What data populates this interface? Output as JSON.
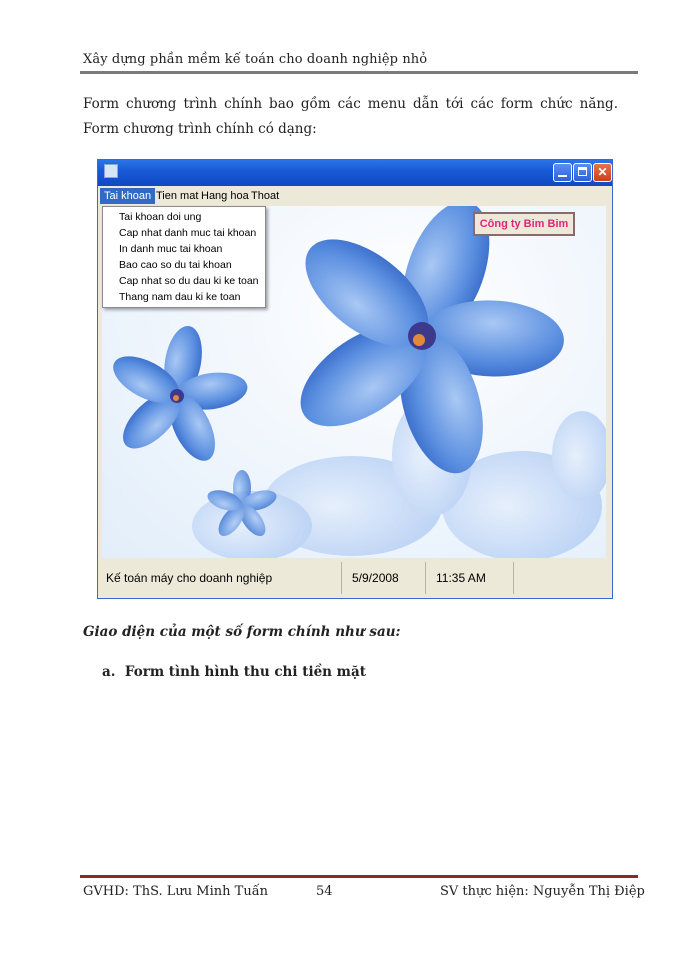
{
  "header": {
    "title": "Xây dựng phần mềm kế toán cho doanh nghiệp  nhỏ"
  },
  "intro": "Form chương trình chính bao gồm các menu dẫn tới các form chức năng. Form chương trình chính có dạng:",
  "app_window": {
    "menu": [
      {
        "label": "Tai khoan",
        "active": true
      },
      {
        "label": "Tien mat",
        "active": false
      },
      {
        "label": "Hang hoa",
        "active": false
      },
      {
        "label": "Thoat",
        "active": false
      }
    ],
    "dropdown_items": [
      "Tai khoan doi ung",
      "Cap nhat danh muc tai khoan",
      "In danh muc tai khoan",
      "Bao cao so du tai khoan",
      "Cap nhat so du dau ki ke toan",
      "Thang nam dau ki ke toan"
    ],
    "company_label": "Công ty Bim Bim",
    "status": {
      "app_name": "Kế toán máy cho doanh nghiệp",
      "date": "5/9/2008",
      "time": "11:35 AM"
    },
    "colors": {
      "titlebar": "#1a5ad8",
      "menu_highlight": "#316ac5",
      "company_text": "#e0257a",
      "flower": "#5b8fe0"
    }
  },
  "sub_heading": "Giao diện của một số form chính như sau:",
  "section_item": {
    "marker": "a.",
    "label": "Form tình hình thu chi tiền mặt"
  },
  "footer": {
    "left": "GVHD: ThS. Lưu Minh  Tuấn",
    "page": "54",
    "right": "SV thực hiện:  Nguyễn  Thị Điệp"
  }
}
